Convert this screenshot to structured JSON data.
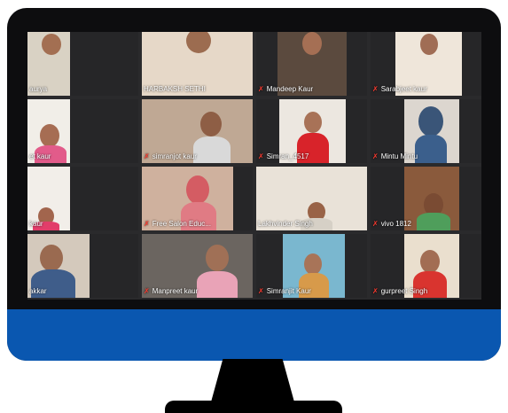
{
  "meeting": {
    "participants": [
      {
        "name": "aurya",
        "muted": false
      },
      {
        "name": "HARBAKSH SETHI",
        "muted": false
      },
      {
        "name": "Mandeep Kaur",
        "muted": true
      },
      {
        "name": "Sarabjeet kaur",
        "muted": true
      },
      {
        "name": "et kaur",
        "muted": false
      },
      {
        "name": "simranjot kaur",
        "muted": true
      },
      {
        "name": "Simran_4517",
        "muted": true
      },
      {
        "name": "Mintu Mintu",
        "muted": true
      },
      {
        "name": "kaur",
        "muted": false
      },
      {
        "name": "Free Salon Educ...",
        "muted": true
      },
      {
        "name": "Lakhvinder Singh",
        "muted": false
      },
      {
        "name": "vivo 1812",
        "muted": true
      },
      {
        "name": "akkar",
        "muted": false
      },
      {
        "name": "Manpreet kaur",
        "muted": true
      },
      {
        "name": "Simranjit Kaur",
        "muted": true
      },
      {
        "name": "gurpreet Singh",
        "muted": true
      }
    ]
  },
  "colors": {
    "monitor_bezel": "#0d0d0f",
    "monitor_chin": "#0a57b0",
    "tile_bg": "#262628",
    "muted_icon": "#ff3b30"
  },
  "icons": {
    "muted": "mic-off-icon"
  }
}
